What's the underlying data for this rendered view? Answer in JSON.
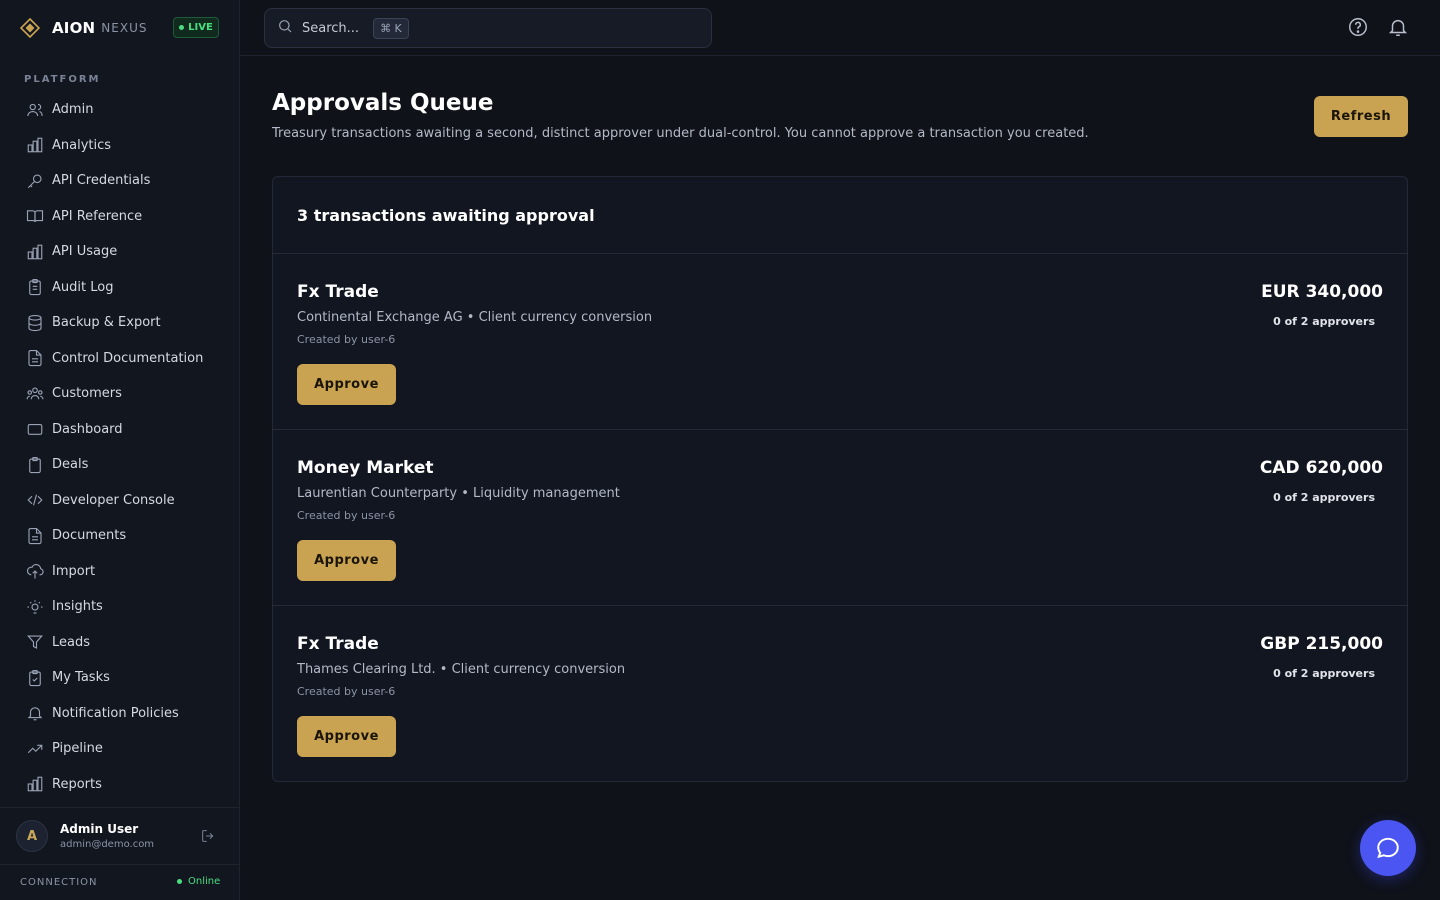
{
  "brand": {
    "name": "AION",
    "suffix": "NEXUS",
    "badge": "LIVE"
  },
  "sidebar": {
    "section": "PLATFORM",
    "items": [
      {
        "label": "Admin",
        "icon": "users-icon"
      },
      {
        "label": "Analytics",
        "icon": "bar-chart-icon"
      },
      {
        "label": "API Credentials",
        "icon": "key-icon"
      },
      {
        "label": "API Reference",
        "icon": "book-icon"
      },
      {
        "label": "API Usage",
        "icon": "bar-chart-icon"
      },
      {
        "label": "Audit Log",
        "icon": "clipboard-list-icon"
      },
      {
        "label": "Backup & Export",
        "icon": "database-icon"
      },
      {
        "label": "Control Documentation",
        "icon": "file-text-icon"
      },
      {
        "label": "Customers",
        "icon": "users-group-icon"
      },
      {
        "label": "Dashboard",
        "icon": "rectangle-icon"
      },
      {
        "label": "Deals",
        "icon": "clipboard-icon"
      },
      {
        "label": "Developer Console",
        "icon": "code-icon"
      },
      {
        "label": "Documents",
        "icon": "file-text-icon"
      },
      {
        "label": "Import",
        "icon": "cloud-upload-icon"
      },
      {
        "label": "Insights",
        "icon": "lightbulb-icon"
      },
      {
        "label": "Leads",
        "icon": "funnel-icon"
      },
      {
        "label": "My Tasks",
        "icon": "clipboard-check-icon"
      },
      {
        "label": "Notification Policies",
        "icon": "bell-icon"
      },
      {
        "label": "Pipeline",
        "icon": "trending-up-icon"
      },
      {
        "label": "Reports",
        "icon": "bar-chart-icon"
      }
    ],
    "user": {
      "initial": "A",
      "name": "Admin User",
      "email": "admin@demo.com"
    },
    "connection": {
      "label": "CONNECTION",
      "status": "Online"
    }
  },
  "topbar": {
    "search_placeholder": "Search...",
    "shortcut": "⌘ K"
  },
  "main": {
    "title": "Approvals Queue",
    "subtitle": "Treasury transactions awaiting a second, distinct approver under dual-control. You cannot approve a transaction you created.",
    "refresh_label": "Refresh",
    "panel_title": "3 transactions awaiting approval",
    "transactions": [
      {
        "type": "Fx Trade",
        "description": "Continental Exchange AG • Client currency conversion",
        "created": "Created by user-6",
        "amount": "EUR 340,000",
        "approvers": "0 of 2 approvers",
        "action": "Approve"
      },
      {
        "type": "Money Market",
        "description": "Laurentian Counterparty • Liquidity management",
        "created": "Created by user-6",
        "amount": "CAD 620,000",
        "approvers": "0 of 2 approvers",
        "action": "Approve"
      },
      {
        "type": "Fx Trade",
        "description": "Thames Clearing Ltd. • Client currency conversion",
        "created": "Created by user-6",
        "amount": "GBP 215,000",
        "approvers": "0 of 2 approvers",
        "action": "Approve"
      }
    ]
  },
  "colors": {
    "accent": "#c9a352",
    "online": "#4ade80",
    "fab": "#4a55f2",
    "background": "#0f1219"
  }
}
